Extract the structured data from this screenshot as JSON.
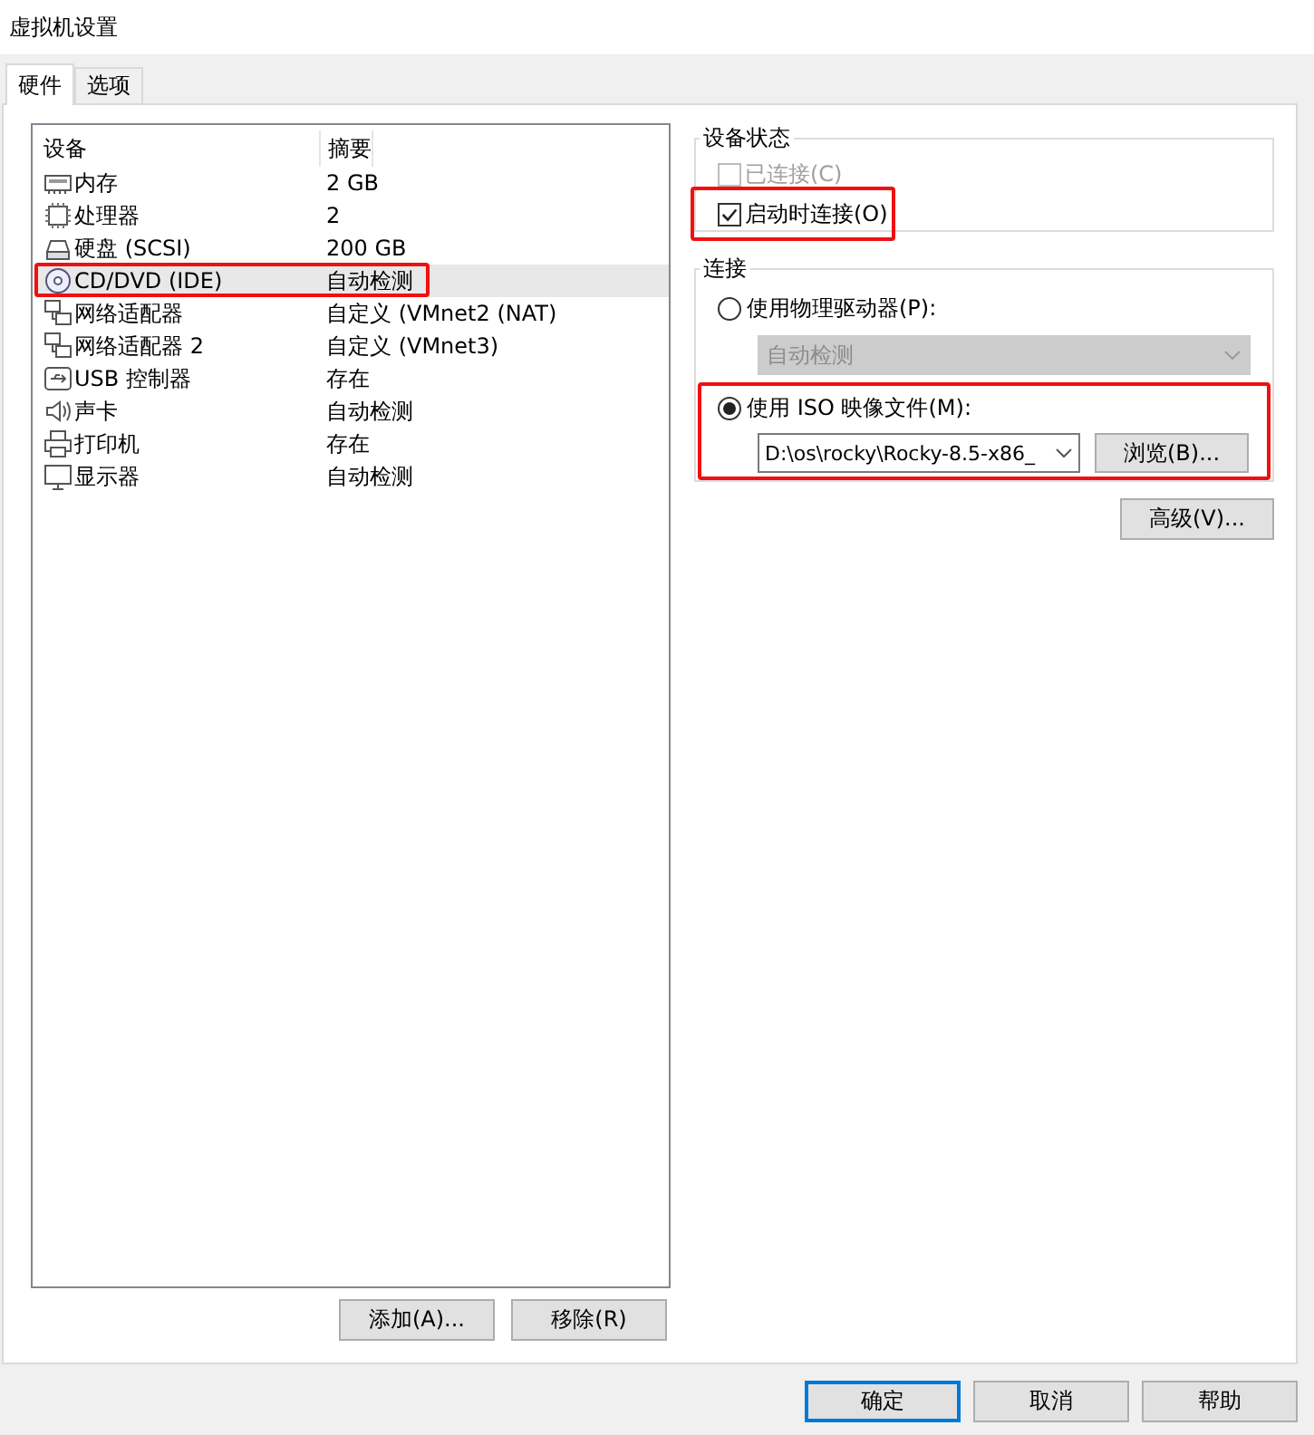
{
  "window": {
    "title": "虚拟机设置"
  },
  "tabs": [
    {
      "label": "硬件",
      "selected": true
    },
    {
      "label": "选项",
      "selected": false
    }
  ],
  "devices": {
    "columns": [
      "设备",
      "摘要"
    ],
    "rows": [
      {
        "kind": "memory",
        "name": "内存",
        "summary": "2 GB",
        "selected": false,
        "highlighted": false
      },
      {
        "kind": "cpu",
        "name": "处理器",
        "summary": "2",
        "selected": false,
        "highlighted": false
      },
      {
        "kind": "disk",
        "name": "硬盘 (SCSI)",
        "summary": "200 GB",
        "selected": false,
        "highlighted": false
      },
      {
        "kind": "cd",
        "name": "CD/DVD (IDE)",
        "summary": "自动检测",
        "selected": true,
        "highlighted": true
      },
      {
        "kind": "network",
        "name": "网络适配器",
        "summary": "自定义 (VMnet2 (NAT)",
        "selected": false,
        "highlighted": false
      },
      {
        "kind": "network",
        "name": "网络适配器 2",
        "summary": "自定义 (VMnet3)",
        "selected": false,
        "highlighted": false
      },
      {
        "kind": "usb",
        "name": "USB 控制器",
        "summary": "存在",
        "selected": false,
        "highlighted": false
      },
      {
        "kind": "sound",
        "name": "声卡",
        "summary": "自动检测",
        "selected": false,
        "highlighted": false
      },
      {
        "kind": "printer",
        "name": "打印机",
        "summary": "存在",
        "selected": false,
        "highlighted": false
      },
      {
        "kind": "monitor",
        "name": "显示器",
        "summary": "自动检测",
        "selected": false,
        "highlighted": false
      }
    ],
    "buttons": [
      "添加(A)...",
      "移除(R)"
    ]
  },
  "device_status": {
    "title": "设备状态",
    "options": [
      {
        "label": "已连接(C)",
        "checked": false,
        "disabled": true,
        "highlighted": false
      },
      {
        "label": "启动时连接(O)",
        "checked": true,
        "disabled": false,
        "highlighted": true
      }
    ]
  },
  "connection": {
    "title": "连接",
    "physical": {
      "label": "使用物理驱动器(P):",
      "selected": false,
      "dropdown": {
        "value": "自动检测",
        "disabled": true
      }
    },
    "iso": {
      "label": "使用 ISO 映像文件(M):",
      "selected": true,
      "highlighted": true,
      "path": "D:\\os\\rocky\\Rocky-8.5-x86_",
      "browse": "浏览(B)..."
    }
  },
  "advanced_button": "高级(V)...",
  "footer_buttons": [
    {
      "label": "确定",
      "default": true
    },
    {
      "label": "取消",
      "default": false
    },
    {
      "label": "帮助",
      "default": false
    }
  ]
}
